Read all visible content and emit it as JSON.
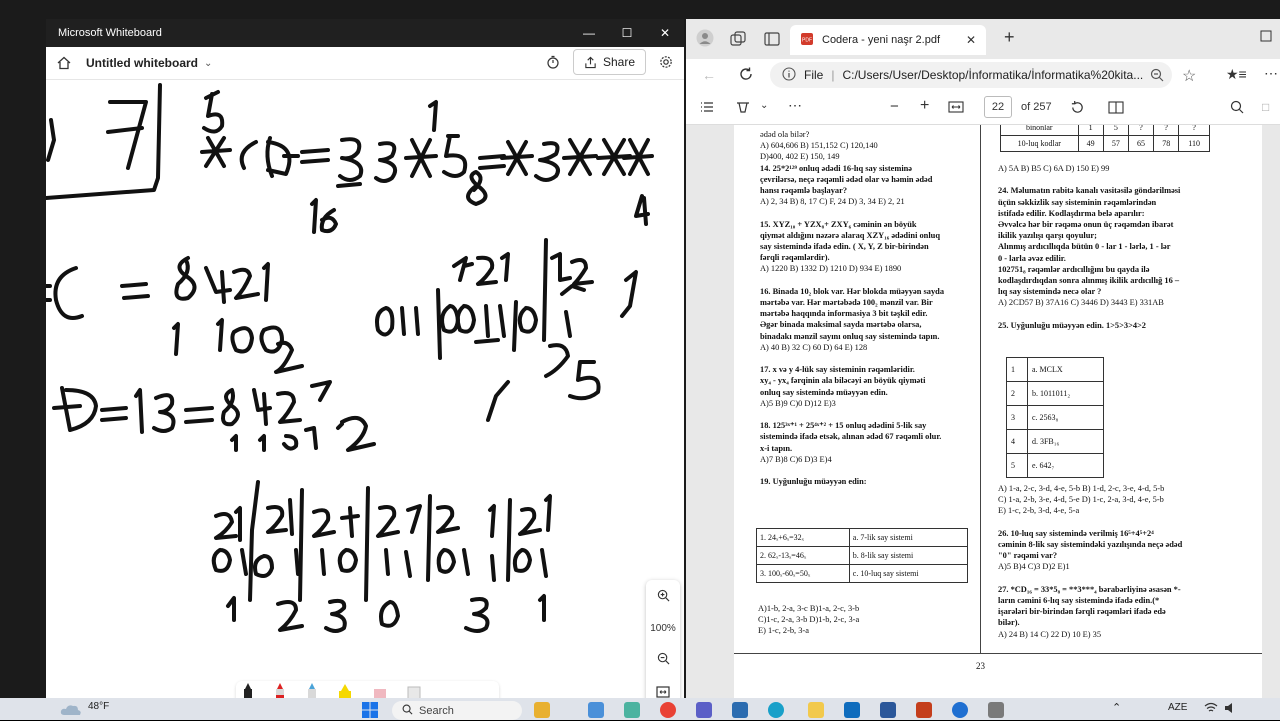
{
  "whiteboard": {
    "window_title": "Microsoft Whiteboard",
    "board_name": "Untitled whiteboard",
    "share_label": "Share",
    "zoom": "100%",
    "ink_color": "#111111"
  },
  "browser": {
    "tab_title": "Codera - yeni naşr 2.pdf",
    "url_prefix": "File",
    "url": "C:/Users/User/Desktop/İnformatika/İnformatika%20kita...",
    "page_current": "22",
    "page_total": "of 257",
    "pdf_page_number": "23"
  },
  "pdf_left": [
    {
      "t": "ədəd ola bilər?",
      "b": false
    },
    {
      "t": "A) 604,606        B) 151,152        C) 120,140",
      "b": false
    },
    {
      "t": "D)400, 402        E) 150, 149",
      "b": false
    },
    {
      "t": "14. 25*2¹²⁹ onluq ədədi 16-lıq say sisteminə",
      "b": true
    },
    {
      "t": "çevrilərsə, neçə rəqəmli ədəd olar və həmin ədəd",
      "b": true
    },
    {
      "t": "hansı rəqəmlə başlayar?",
      "b": true
    },
    {
      "t": "A) 2, 34   B) 8, 17  C) F, 24  D) 3, 34  E) 2, 21",
      "b": false
    },
    {
      "t": "",
      "b": false
    },
    {
      "t": "15. XYZ₁₀ + YZX₈+ ZXY₆  cəminin ən böyük",
      "b": true
    },
    {
      "t": "qiymət aldığını nəzərə alaraq XZY₁₆ ədədini onluq",
      "b": true
    },
    {
      "t": "say sistemində ifadə edin. ( X, Y, Z bir-birindən",
      "b": true
    },
    {
      "t": "fərqli rəqəmlərdir).",
      "b": true
    },
    {
      "t": "A) 1220   B) 1332   D) 1210   D) 934   E) 1890",
      "b": false
    },
    {
      "t": "",
      "b": false
    },
    {
      "t": "16. Binada 10₂ blok var. Hər blokda müəyyən sayda",
      "b": true
    },
    {
      "t": "mərtəbə var. Hər mərtəbədə 100₂ mənzil var. Bir",
      "b": true
    },
    {
      "t": "mərtəbə haqqında informasiya 3 bit təşkil edir.",
      "b": true
    },
    {
      "t": "Əgər binada maksimal sayda mərtəbə olarsa,",
      "b": true
    },
    {
      "t": "binadakı mənzil sayını onluq say sistemində tapın.",
      "b": true
    },
    {
      "t": "A) 40   B) 32   C) 60  D) 64  E) 128",
      "b": false
    },
    {
      "t": "",
      "b": false
    },
    {
      "t": "17. x və y 4-lük say sisteminin rəqəmləridir.",
      "b": true
    },
    {
      "t": "xy₄ - yx₄ fərqinin ala biləcəyi ən böyük qiyməti",
      "b": true
    },
    {
      "t": "onluq say sistemində müəyyən edin.",
      "b": true
    },
    {
      "t": "A)5        B)9        C)0        D)12       E)3",
      "b": false
    },
    {
      "t": "",
      "b": false
    },
    {
      "t": "18. 125³ˣ⁺¹ + 25⁴ˣ⁺² + 15 onluq ədədini 5-lik say",
      "b": true
    },
    {
      "t": "sistemində ifadə etsək, alınan ədəd 67 rəqəmli olur.",
      "b": true
    },
    {
      "t": "x-i tapın.",
      "b": true
    },
    {
      "t": "A)7          B)8          C)6          D)3          E)4",
      "b": false
    },
    {
      "t": "",
      "b": false
    },
    {
      "t": "19. Uyğunluğu müəyyən edin:",
      "b": true
    }
  ],
  "table19": [
    [
      "1. 24ₓ+6ₓ=32ₓ",
      "a. 7-lik say sistemi"
    ],
    [
      "2. 62ₓ-13ₓ=46ₓ",
      "b. 8-lik say sistemi"
    ],
    [
      "3. 100ₓ-60ₓ=50ₓ",
      "c. 10-luq say sistemi"
    ]
  ],
  "pdf_left_after": [
    "A)1-b, 2-a, 3-c     B)1-a, 2-c, 3-b",
    "C)1-c, 2-a, 3-b     D)1-b, 2-c, 3-a",
    "E) 1-c, 2-b, 3-a"
  ],
  "table_top": {
    "row1": [
      "binonlar",
      "1",
      "5",
      "?",
      "?",
      "?"
    ],
    "row2": [
      "10-luq kodlar",
      "49",
      "57",
      "65",
      "78",
      "110"
    ]
  },
  "pdf_right": [
    {
      "t": "A) 5A      B) B5      C) 6A      D) 150      E) 99",
      "b": false
    },
    {
      "t": "",
      "b": false
    },
    {
      "t": "24. Məlumatın rabitə kanalı vasitəsilə göndərilməsi",
      "b": true
    },
    {
      "t": "üçün səkkizlik say sisteminin rəqəmlərindən",
      "b": true
    },
    {
      "t": "istifadə edilir.  Kodlaşdırma belə aparılır:",
      "b": true
    },
    {
      "t": "Əvvəlcə hər bir rəqəmə onun üç rəqəmdən ibarət",
      "b": true
    },
    {
      "t": "ikilik yazılışı qarşı qoyulur;",
      "b": true
    },
    {
      "t": "Alınmış ardıcıllıqda bütün 0 - lar 1 - lərlə, 1 - lər",
      "b": true
    },
    {
      "t": "0 - larla əvəz edilir.",
      "b": true
    },
    {
      "t": "102751₈  rəqəmlər ardıcıllığını bu qayda ilə",
      "b": true
    },
    {
      "t": "kodlaşdırdıqdan sonra alınmış ikilik ardıcıllığ 16 –",
      "b": true
    },
    {
      "t": "lıq say sistemində necə olar ?",
      "b": true
    },
    {
      "t": "A) 2CD57  B) 37A16   C) 3446  D) 3443   E) 331AB",
      "b": false
    },
    {
      "t": "",
      "b": false
    },
    {
      "t": "25. Uyğunluğu müəyyən edin. 1>5>3>4>2",
      "b": true
    }
  ],
  "table25": [
    [
      "1",
      "a. MCLX"
    ],
    [
      "2",
      "b. 1011011₂"
    ],
    [
      "3",
      "c. 2563₈"
    ],
    [
      "4",
      "d. 3FB₁₆"
    ],
    [
      "5",
      "e. 642₇"
    ]
  ],
  "pdf_right_after": [
    {
      "t": "A) 1-a, 2-c, 3-d, 4-e, 5-b       B) 1-d, 2-c, 3-e, 4-d, 5-b",
      "b": false
    },
    {
      "t": "C) 1-a, 2-b, 3-e, 4-d, 5-e       D) 1-c, 2-a, 3-d, 4-e, 5-b",
      "b": false
    },
    {
      "t": "E) 1-c, 2-b, 3-d, 4-e, 5-a",
      "b": false
    },
    {
      "t": "",
      "b": false
    },
    {
      "t": "26. 10-luq say sistemində verilmiş 16⁵+4⁵+2⁴",
      "b": true
    },
    {
      "t": "cəminin 8-lik say sistemindəki yazılışında neçə ədəd",
      "b": true
    },
    {
      "t": "\"0\" rəqəmi var?",
      "b": true
    },
    {
      "t": "A)5       B)4       C)3        D)2        E)1",
      "b": false
    },
    {
      "t": "",
      "b": false
    },
    {
      "t": "27. *CD₁₆ = 33*5₈ = **3***₄ bərabərliyinə əsasən *-",
      "b": true
    },
    {
      "t": "ların cəmini 6-lıq say sistemində ifadə edin.(*",
      "b": true
    },
    {
      "t": "işarələri bir-birindən fərqli rəqəmləri ifadə edə",
      "b": true
    },
    {
      "t": "bilər).",
      "b": true
    },
    {
      "t": "A) 24       B) 14       C) 22       D) 10       E) 35",
      "b": false
    }
  ],
  "taskbar": {
    "weather": "48°F",
    "search_placeholder": "Search",
    "lang": "AZE"
  }
}
